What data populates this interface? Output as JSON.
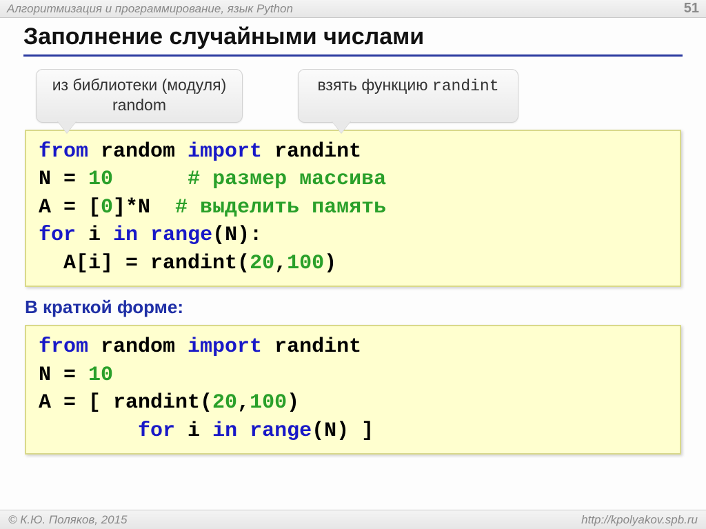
{
  "header": {
    "course": "Алгоритмизация и программирование, язык Python",
    "page": "51"
  },
  "title": "Заполнение случайными числами",
  "callouts": {
    "left_line1": "из библиотеки (модуля)",
    "left_line2": "random",
    "right_prefix": "взять функцию ",
    "right_mono": "randint"
  },
  "code1": {
    "l1_from": "from",
    "l1_mod": " random ",
    "l1_import": "import",
    "l1_name": " randint",
    "l2_a": "N = ",
    "l2_num": "10",
    "l2_pad": "      ",
    "l2_cmt": "# размер массива",
    "l3_a": "A = [",
    "l3_zero": "0",
    "l3_b": "]*N  ",
    "l3_cmt": "# выделить память",
    "l4_for": "for",
    "l4_mid": " i ",
    "l4_in": "in",
    "l4_sp": " ",
    "l4_range": "range",
    "l4_tail": "(N):",
    "l5_a": "  A[i] = randint(",
    "l5_n1": "20",
    "l5_c": ",",
    "l5_n2": "100",
    "l5_b": ")"
  },
  "subhead": "В краткой форме:",
  "code2": {
    "l1_from": "from",
    "l1_mod": " random ",
    "l1_import": "import",
    "l1_name": " randint",
    "l2_a": "N = ",
    "l2_num": "10",
    "l3_a": "A = [ randint(",
    "l3_n1": "20",
    "l3_c": ",",
    "l3_n2": "100",
    "l3_b": ") ",
    "l4_pad": "        ",
    "l4_for": "for",
    "l4_mid": " i ",
    "l4_in": "in",
    "l4_sp": " ",
    "l4_range": "range",
    "l4_tail": "(N) ]"
  },
  "footer": {
    "copyright": "© К.Ю. Поляков, 2015",
    "url": "http://kpolyakov.spb.ru"
  }
}
